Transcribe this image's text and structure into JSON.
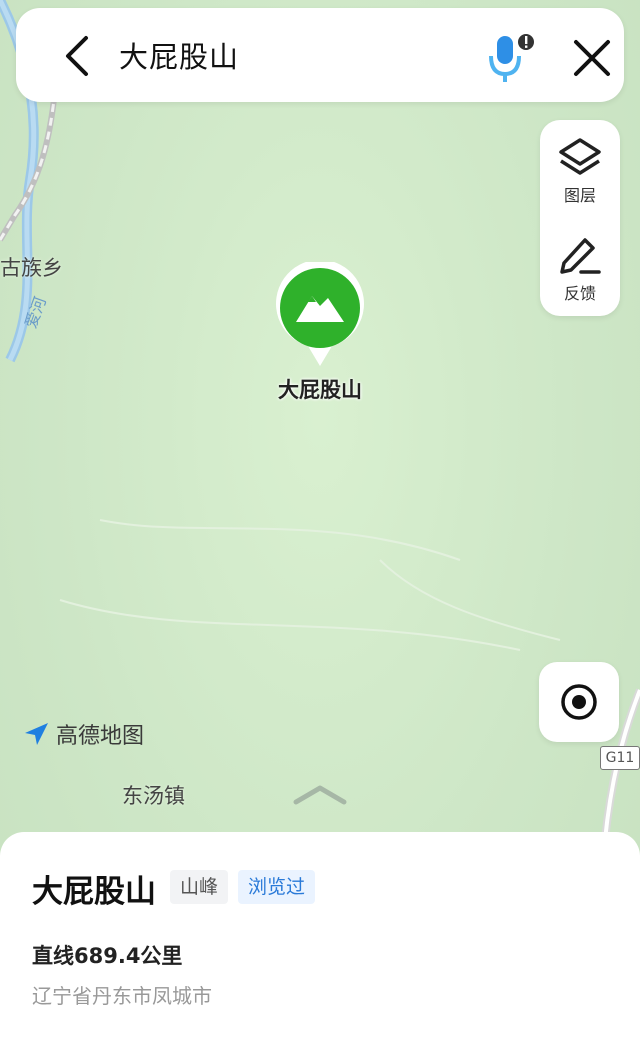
{
  "search": {
    "query": "大屁股山"
  },
  "tools": {
    "layers_label": "图层",
    "feedback_label": "反馈"
  },
  "map": {
    "poi_name": "大屁股山",
    "places": {
      "town_left": "古族乡",
      "town_bottom": "东汤镇"
    },
    "river": "爱河",
    "highway_badge": "G11",
    "brand": "高德地图",
    "colors": {
      "land": "#cfe8c9",
      "water": "#9cc8e8",
      "poi_green": "#2fb12b"
    }
  },
  "sheet": {
    "title": "大屁股山",
    "category_tag": "山峰",
    "viewed_tag": "浏览过",
    "distance": "直线689.4公里",
    "address": "辽宁省丹东市凤城市"
  },
  "icons": [
    "back-arrow-icon",
    "mic-icon",
    "close-icon",
    "layers-icon",
    "pencil-icon",
    "locate-icon",
    "mountain-icon",
    "gaode-logo-icon",
    "chevron-up-icon"
  ]
}
